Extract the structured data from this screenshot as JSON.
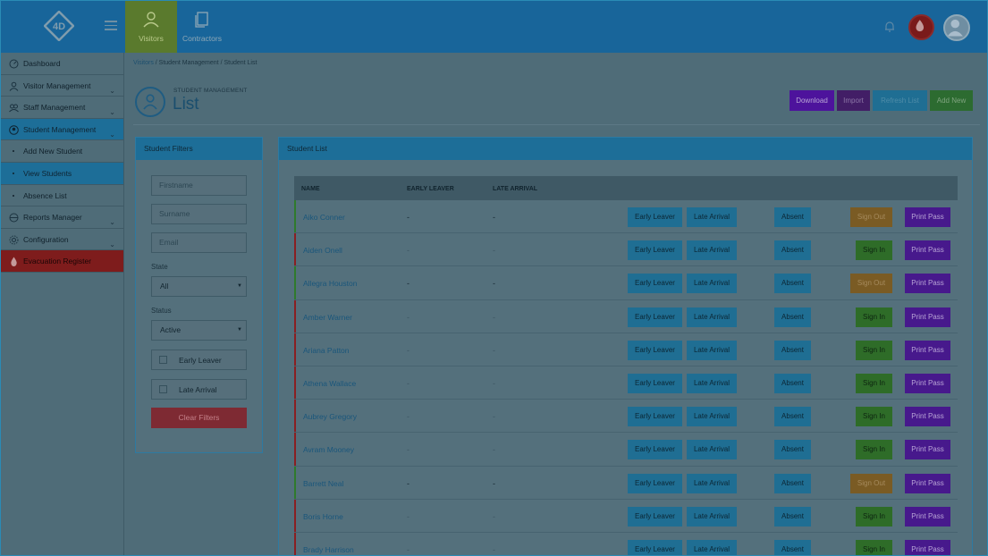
{
  "topbar": {
    "tabs": [
      {
        "label": "Visitors",
        "icon": "person-icon"
      },
      {
        "label": "Contractors",
        "icon": "documents-icon"
      }
    ],
    "logo_text": "4D"
  },
  "sidebar": {
    "items": [
      {
        "label": "Dashboard"
      },
      {
        "label": "Visitor Management"
      },
      {
        "label": "Staff Management"
      },
      {
        "label": "Student Management"
      },
      {
        "label": "Add New Student"
      },
      {
        "label": "View Students"
      },
      {
        "label": "Absence List"
      },
      {
        "label": "Reports Manager"
      },
      {
        "label": "Configuration"
      },
      {
        "label": "Evacuation Register"
      }
    ]
  },
  "breadcrumb": [
    "Visitors",
    "Student Management",
    "Student List"
  ],
  "page": {
    "section": "STUDENT MANAGEMENT",
    "title": "List"
  },
  "actions": {
    "download": "Download",
    "import": "Import",
    "refresh": "Refresh List",
    "add_new": "Add New"
  },
  "filters": {
    "title": "Student Filters",
    "firstname_placeholder": "Firstname",
    "surname_placeholder": "Surname",
    "email_placeholder": "Email",
    "state_label": "State",
    "state_value": "All",
    "status_label": "Status",
    "status_value": "Active",
    "early_leaver": "Early Leaver",
    "late_arrival": "Late Arrival",
    "clear": "Clear Filters"
  },
  "list": {
    "title": "Student List",
    "columns": [
      "NAME",
      "EARLY LEAVER",
      "LATE ARRIVAL"
    ],
    "buttons": {
      "early": "Early Leaver",
      "late": "Late Arrival",
      "absent": "Absent",
      "sign_in": "Sign In",
      "sign_out": "Sign Out",
      "print": "Print Pass"
    },
    "rows": [
      {
        "name": "Aiko Conner",
        "early": "-",
        "late": "-",
        "status": "in"
      },
      {
        "name": "Aiden Onell",
        "early": "-",
        "late": "-",
        "status": "out"
      },
      {
        "name": "Allegra Houston",
        "early": "-",
        "late": "-",
        "status": "in"
      },
      {
        "name": "Amber Warner",
        "early": "-",
        "late": "-",
        "status": "out"
      },
      {
        "name": "Ariana Patton",
        "early": "-",
        "late": "-",
        "status": "out"
      },
      {
        "name": "Athena Wallace",
        "early": "-",
        "late": "-",
        "status": "out"
      },
      {
        "name": "Aubrey Gregory",
        "early": "-",
        "late": "-",
        "status": "out"
      },
      {
        "name": "Avram Mooney",
        "early": "-",
        "late": "-",
        "status": "out"
      },
      {
        "name": "Barrett Neal",
        "early": "-",
        "late": "-",
        "status": "in"
      },
      {
        "name": "Boris Horne",
        "early": "-",
        "late": "-",
        "status": "out"
      },
      {
        "name": "Brady Harrison",
        "early": "-",
        "late": "-",
        "status": "out"
      }
    ]
  },
  "colors": {
    "status_in": "#2f7a2c",
    "status_out": "#8a1f22",
    "primary": "#1f6e93"
  }
}
